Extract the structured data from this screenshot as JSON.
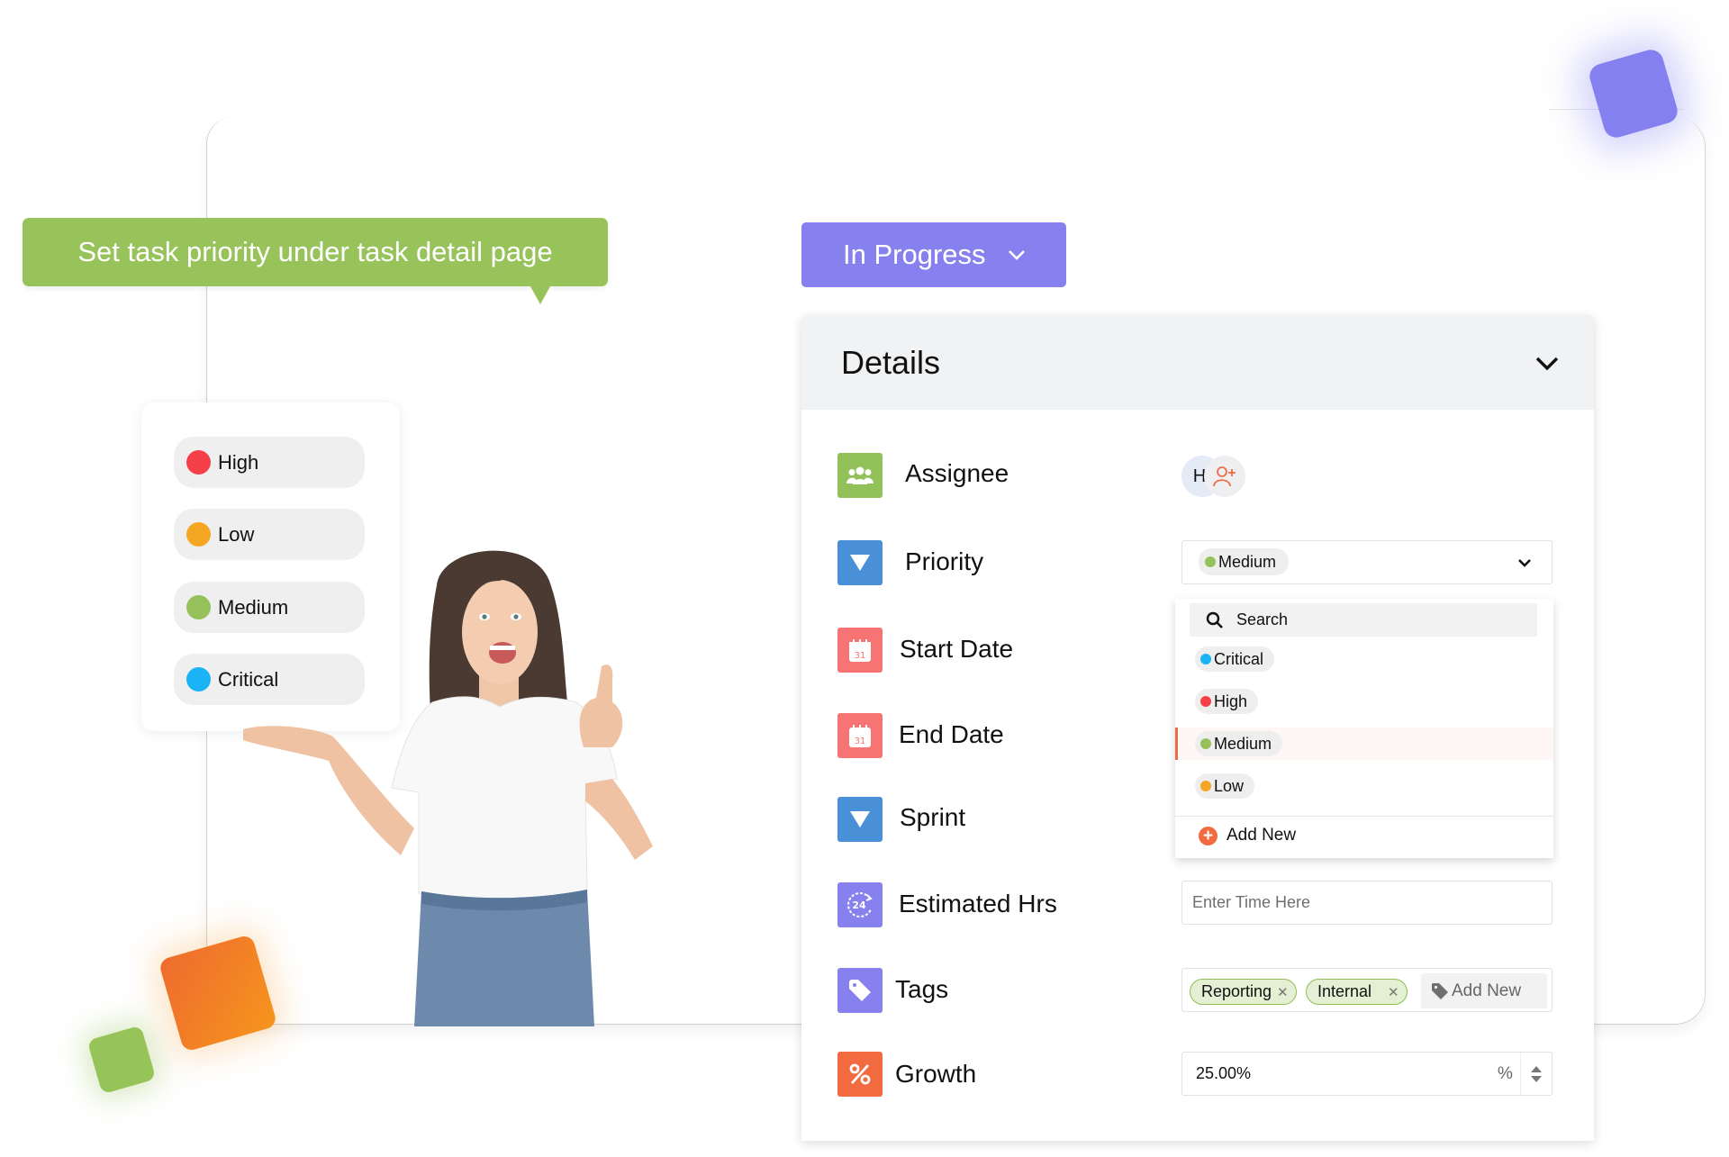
{
  "banner": {
    "text": "Set task priority under task detail page"
  },
  "priority_legend": {
    "items": [
      {
        "label": "High",
        "color": "#f5404a"
      },
      {
        "label": "Low",
        "color": "#f5a623"
      },
      {
        "label": "Medium",
        "color": "#96c15a"
      },
      {
        "label": "Critical",
        "color": "#1ab3f5"
      }
    ]
  },
  "status_button": {
    "label": "In Progress",
    "color": "#8681ef"
  },
  "details": {
    "title": "Details",
    "rows": {
      "assignee": {
        "label": "Assignee",
        "avatar_initial": "H"
      },
      "priority": {
        "label": "Priority",
        "value": "Medium",
        "value_color": "#96c15a"
      },
      "start_date": {
        "label": "Start Date",
        "icon_text": "31"
      },
      "end_date": {
        "label": "End Date",
        "icon_text": "31"
      },
      "sprint": {
        "label": "Sprint"
      },
      "estimated_hrs": {
        "label": "Estimated Hrs",
        "placeholder": "Enter Time Here",
        "icon_text": "24"
      },
      "tags": {
        "label": "Tags",
        "items": [
          "Reporting",
          "Internal"
        ],
        "add_label": "Add New"
      },
      "growth": {
        "label": "Growth",
        "value": "25.00%",
        "suffix": "%"
      }
    }
  },
  "priority_dropdown": {
    "search_placeholder": "Search",
    "options": [
      {
        "label": "Critical",
        "color": "#1ab3f5",
        "selected": false
      },
      {
        "label": "High",
        "color": "#f5404a",
        "selected": false
      },
      {
        "label": "Medium",
        "color": "#96c15a",
        "selected": true
      },
      {
        "label": "Low",
        "color": "#f5a623",
        "selected": false
      }
    ],
    "add_label": "Add New"
  },
  "icons": {
    "assignee": "group-icon",
    "priority": "triangle-down-icon",
    "start_date": "calendar-icon",
    "end_date": "calendar-icon",
    "sprint": "triangle-down-icon",
    "estimated_hrs": "clock-24-icon",
    "tags": "tag-icon",
    "growth": "percent-icon"
  },
  "colors": {
    "green": "#97c35a",
    "purple": "#8681ef",
    "blue": "#4a90d9",
    "coral": "#f67474",
    "orange": "#f26a40"
  }
}
